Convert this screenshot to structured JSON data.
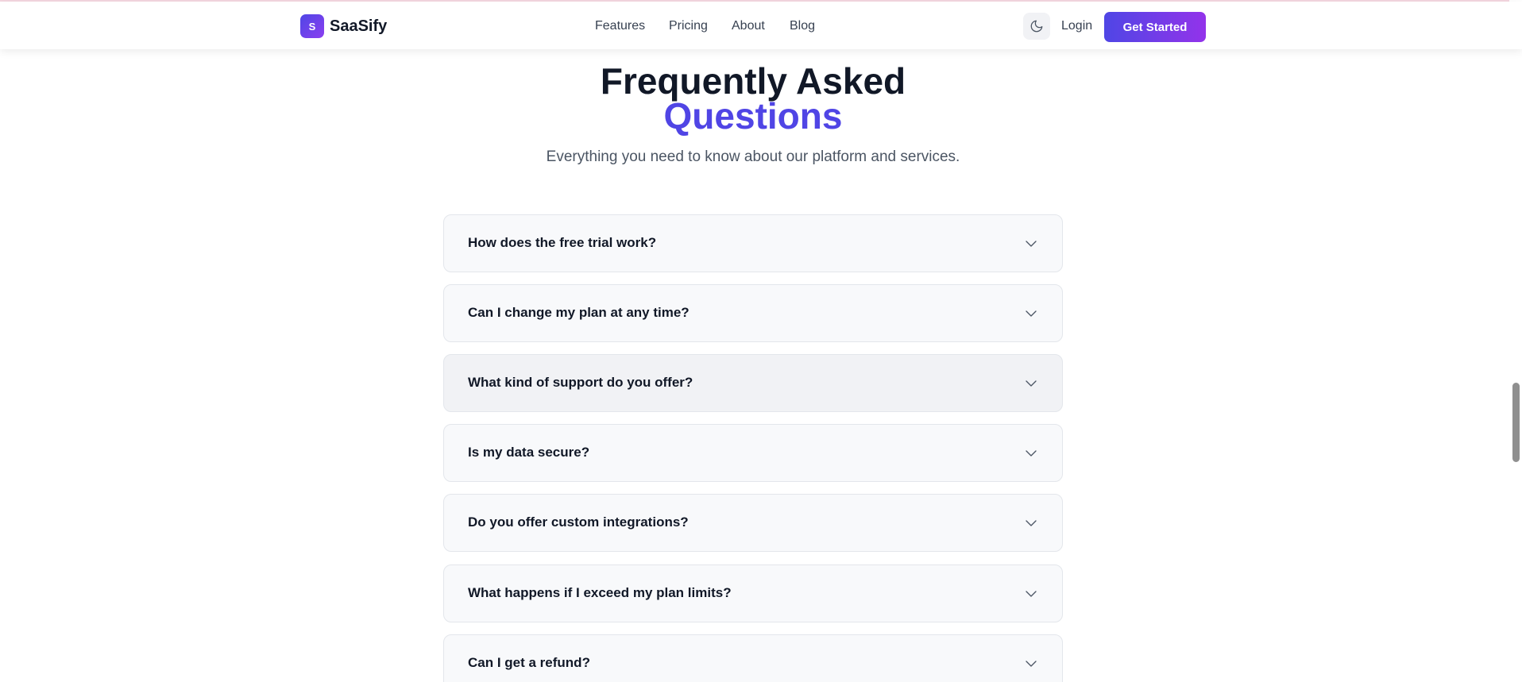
{
  "header": {
    "logo_letter": "S",
    "brand": "SaaSify",
    "nav": [
      "Features",
      "Pricing",
      "About",
      "Blog"
    ],
    "theme_toggle_icon": "moon-icon",
    "login_label": "Login",
    "cta_label": "Get Started"
  },
  "hero": {
    "title_line1": "Frequently Asked",
    "title_line2": "Questions",
    "subtitle": "Everything you need to know about our platform and services."
  },
  "faq": {
    "items": [
      "How does the free trial work?",
      "Can I change my plan at any time?",
      "What kind of support do you offer?",
      "Is my data secure?",
      "Do you offer custom integrations?",
      "What happens if I exceed my plan limits?",
      "Can I get a refund?"
    ],
    "expand_icon": "chevron-down-icon"
  },
  "colors": {
    "accent": "#5045e5",
    "gradient_start": "#4f46e5",
    "gradient_end": "#9333ea",
    "faq_bg": "#f8f9fb",
    "faq_hover_bg": "#f1f2f5"
  }
}
